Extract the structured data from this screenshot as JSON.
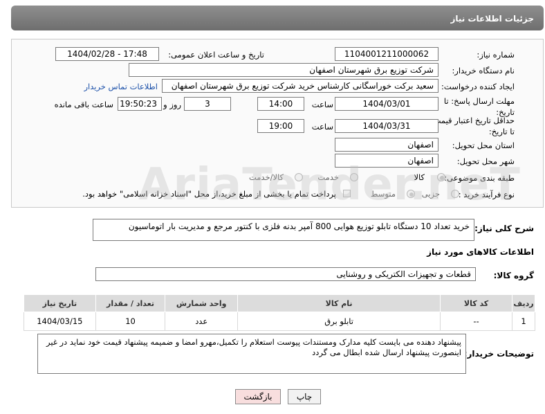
{
  "header": {
    "title": "جزئیات اطلاعات نیاز"
  },
  "form": {
    "need_number_label": "شماره نیاز:",
    "need_number": "1104001211000062",
    "announce_label": "تاریخ و ساعت اعلان عمومی:",
    "announce_value": "1404/02/28 - 17:48",
    "buyer_label": "نام دستگاه خریدار:",
    "buyer_value": "شرکت توزیع برق شهرستان اصفهان",
    "creator_label": "ایجاد کننده درخواست:",
    "creator_value": "سعید برکت خوراسگانی کارشناس خرید شرکت توزیع برق شهرستان اصفهان",
    "contact_link": "اطلاعات تماس خریدار",
    "deadline_label": "مهلت ارسال پاسخ: تا تاریخ:",
    "deadline_date": "1404/03/01",
    "time_label": "ساعت",
    "deadline_time": "14:00",
    "days_value": "3",
    "days_label": "روز و",
    "remaining_time": "19:50:23",
    "remaining_label": "ساعت باقی مانده",
    "validity_label": "حداقل تاریخ اعتبار قیمت: تا تاریخ:",
    "validity_date": "1404/03/31",
    "validity_time": "19:00",
    "province_label": "استان محل تحویل:",
    "province_value": "اصفهان",
    "city_label": "شهر محل تحویل:",
    "city_value": "اصفهان",
    "category_label": "طبقه بندی موضوعی:",
    "category_options": [
      "کالا",
      "خدمت",
      "کالا/خدمت"
    ],
    "process_label": "نوع فرآیند خرید :",
    "process_options": [
      "جزیی",
      "متوسط"
    ],
    "payment_note": "پرداخت تمام یا بخشی از مبلغ خرید،از محل \"اسناد خزانه اسلامی\" خواهد بود."
  },
  "description": {
    "label": "شرح کلی نیاز:",
    "value": "خرید تعداد 10 دستگاه تابلو توزیع هوایی 800 آمپر بدنه فلزی با کنتور مرجع و مدیریت بار اتوماسیون"
  },
  "goods": {
    "section_title": "اطلاعات کالاهای مورد نیاز",
    "group_label": "گروه کالا:",
    "group_value": "قطعات و تجهیزات الکتریکی و روشنایی",
    "columns": [
      "ردیف",
      "کد کالا",
      "نام کالا",
      "واحد شمارش",
      "تعداد / مقدار",
      "تاریخ نیاز"
    ],
    "rows": [
      {
        "row": "1",
        "code": "--",
        "name": "تابلو برق",
        "unit": "عدد",
        "qty": "10",
        "date": "1404/03/15"
      }
    ]
  },
  "notes": {
    "label": "توضیحات خریدار:",
    "value": "پیشنهاد دهنده می بایست کلیه مدارک ومستندات پیوست استعلام را تکمیل،مهرو امضا و ضمیمه پیشنهاد قیمت خود نماید در غیر اینصورت پیشنهاد ارسال شده ابطال می گردد"
  },
  "buttons": {
    "print": "چاپ",
    "back": "بازگشت"
  },
  "watermark": "AriaTender.neT",
  "colors": {
    "header_bg": "#7a7a7a",
    "link": "#1a4fa8",
    "back_button_bg": "#f8dede"
  }
}
